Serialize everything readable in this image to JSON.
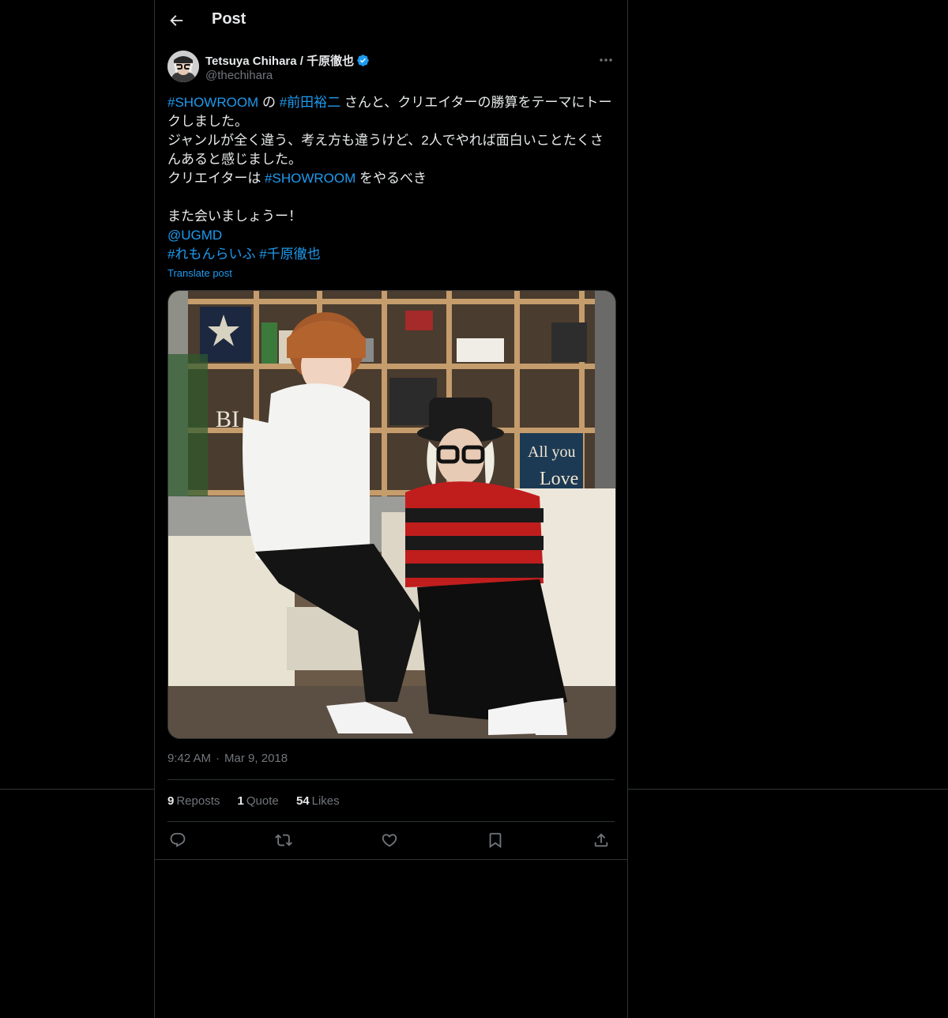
{
  "header": {
    "title": "Post",
    "back_icon": "arrow-left-icon"
  },
  "author": {
    "name": "Tetsuya Chihara / 千原徹也",
    "handle": "@thechihara",
    "verified": true,
    "verified_color": "#1d9bf0"
  },
  "post": {
    "line1": {
      "tag1": "#SHOWROOM",
      "t1": " の ",
      "tag2": "#前田裕二",
      "t2": " さんと、クリエイターの勝算をテーマにトー"
    },
    "line2": "クしました。",
    "line3": "ジャンルが全く違う、考え方も違うけど、2人でやれば面白いことたくさ",
    "line4": "んあると感じました。",
    "line5": {
      "t1": "クリエイターは ",
      "tag": "#SHOWROOM",
      "t2": " をやるべき"
    },
    "line7": "また会いましょうー！",
    "mention": "@UGMD",
    "hashtags": {
      "tag1": "#れもんらいふ",
      "sep": " ",
      "tag2": "#千原徹也"
    },
    "translate": "Translate post"
  },
  "meta": {
    "time": "9:42 AM",
    "dot": "·",
    "date": "Mar 9, 2018"
  },
  "stats": {
    "reposts_count": "9",
    "reposts_label": "Reposts",
    "quotes_count": "1",
    "quotes_label": "Quote",
    "likes_count": "54",
    "likes_label": "Likes"
  },
  "actions": [
    "reply-icon",
    "repost-icon",
    "like-icon",
    "bookmark-icon",
    "share-icon"
  ],
  "colors": {
    "background": "#000000",
    "text": "#e7e9ea",
    "muted": "#71767b",
    "link": "#1d9bf0",
    "border": "#2f3336"
  }
}
